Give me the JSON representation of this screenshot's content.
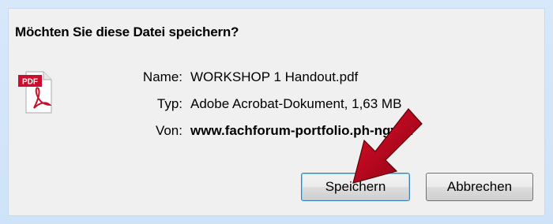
{
  "dialog": {
    "question": "Möchten Sie diese Datei speichern?",
    "fields": {
      "name_label": "Name:",
      "name_value": "WORKSHOP 1 Handout.pdf",
      "type_label": "Typ:",
      "type_value": "Adobe Acrobat-Dokument, 1,63 MB",
      "from_label": "Von:",
      "from_value": "www.fachforum-portfolio.ph-ngv.at"
    },
    "buttons": {
      "save": "Speichern",
      "cancel": "Abbrechen"
    },
    "file_icon": {
      "name": "pdf-file-icon",
      "badge_text": "PDF",
      "badge_color": "#c8102e"
    },
    "annotation_arrow_color": "#c4001a"
  }
}
